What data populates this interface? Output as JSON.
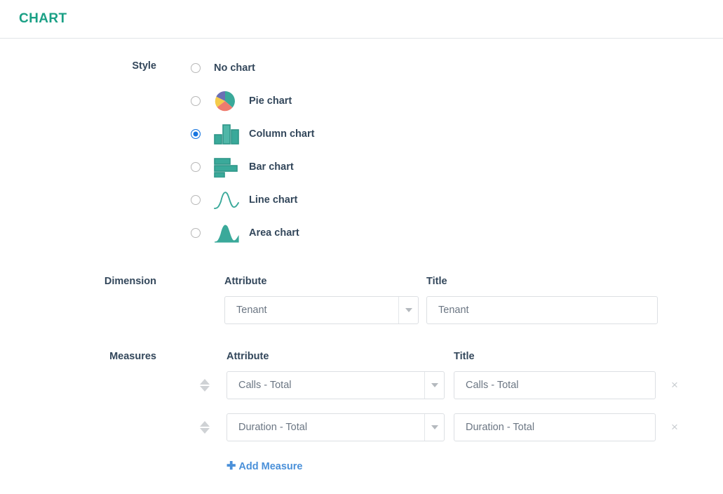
{
  "header": {
    "title": "CHART",
    "accent_color": "#1aa085"
  },
  "style_section": {
    "label": "Style",
    "selected": "column",
    "options": [
      {
        "id": "none",
        "label": "No chart",
        "icon": "none",
        "selected": false
      },
      {
        "id": "pie",
        "label": "Pie chart",
        "icon": "pie-chart-icon",
        "selected": false
      },
      {
        "id": "column",
        "label": "Column chart",
        "icon": "column-chart-icon",
        "selected": true
      },
      {
        "id": "bar",
        "label": "Bar chart",
        "icon": "bar-chart-icon",
        "selected": false
      },
      {
        "id": "line",
        "label": "Line chart",
        "icon": "line-chart-icon",
        "selected": false
      },
      {
        "id": "area",
        "label": "Area chart",
        "icon": "area-chart-icon",
        "selected": false
      }
    ]
  },
  "dimension_section": {
    "label": "Dimension",
    "attribute_heading": "Attribute",
    "title_heading": "Title",
    "attribute_value": "Tenant",
    "title_value": "Tenant",
    "title_placeholder": "Tenant"
  },
  "measures_section": {
    "label": "Measures",
    "attribute_heading": "Attribute",
    "title_heading": "Title",
    "rows": [
      {
        "attribute_value": "Calls - Total",
        "title_value": "Calls - Total",
        "title_placeholder": "Calls - Total",
        "remove_label": "×"
      },
      {
        "attribute_value": "Duration - Total",
        "title_value": "Duration - Total",
        "title_placeholder": "Duration - Total",
        "remove_label": "×"
      }
    ],
    "add_measure_label": "Add Measure",
    "add_measure_plus": "✚",
    "add_measure_color": "#4a90d9"
  },
  "theme": {
    "teal": "#3aa99a",
    "teal_dark": "#2e9688",
    "pie_teal": "#3aa99a",
    "pie_purple": "#6b6fb5",
    "pie_yellow": "#f5cb4a",
    "pie_red": "#ef7b6e",
    "radio_blue": "#1675e0",
    "border": "#dcdfe3",
    "text": "#33475b",
    "value_text": "#6b7683"
  }
}
